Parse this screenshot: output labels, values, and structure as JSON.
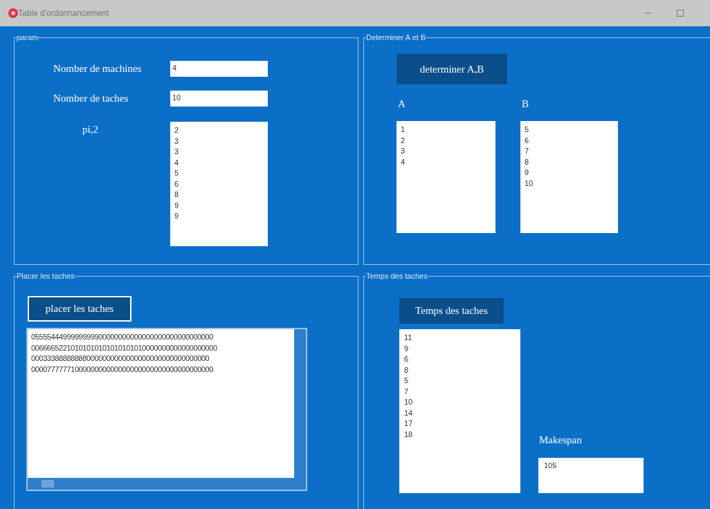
{
  "window": {
    "title": "Table d'ordonnancement"
  },
  "param": {
    "title": "param",
    "fields": [
      {
        "label": "Nomber de machines",
        "value": "4"
      },
      {
        "label": "Nomber de taches",
        "value": "10"
      }
    ],
    "list": {
      "label": "pi,2",
      "items": [
        "2",
        "3",
        "3",
        "4",
        "5",
        "6",
        "8",
        "9",
        "9"
      ]
    }
  },
  "determiner": {
    "title": "Determiner A et B",
    "button": "determiner A,B",
    "lists": [
      {
        "label": "A",
        "items": [
          "1",
          "2",
          "3",
          "4"
        ]
      },
      {
        "label": "B",
        "items": [
          "5",
          "6",
          "7",
          "8",
          "9",
          "10"
        ]
      }
    ]
  },
  "placer": {
    "title": "Placer les taches",
    "button": "placer les taches",
    "lines": [
      "0555544499999999900000000000000000000000000000",
      "00666652210101010101010101010000000000000000000",
      "000333888888880000000000000000000000000000000",
      "0000777777100000000000000000000000000000000000"
    ]
  },
  "temps": {
    "title": "Temps  des taches",
    "button": "Temps des taches",
    "items": [
      "11",
      "9",
      "6",
      "8",
      "5",
      "7",
      "10",
      "14",
      "17",
      "18"
    ],
    "makespan_label": "Makespan",
    "makespan_value": "105"
  }
}
